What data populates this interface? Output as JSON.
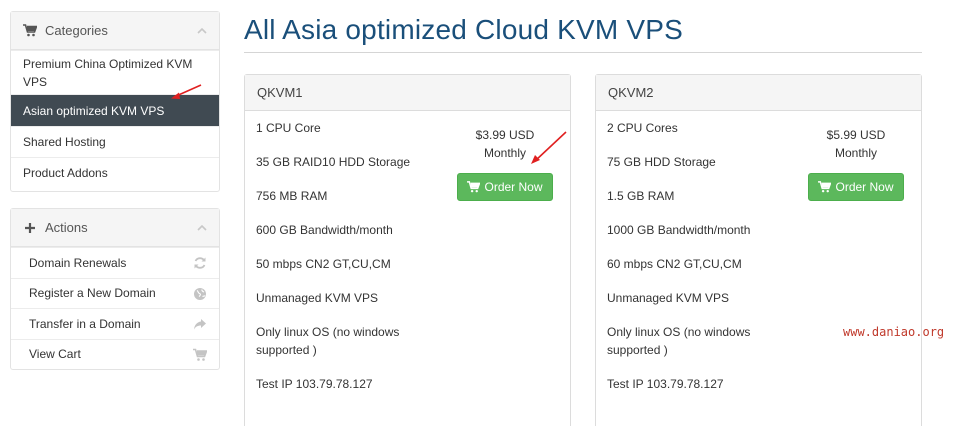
{
  "sidebar": {
    "categories": {
      "title": "Categories",
      "items": [
        {
          "label": "Premium China Optimized KVM VPS"
        },
        {
          "label": "Asian optimized KVM VPS"
        },
        {
          "label": "Shared Hosting"
        },
        {
          "label": "Product Addons"
        }
      ]
    },
    "actions": {
      "title": "Actions",
      "items": [
        {
          "label": "Domain Renewals",
          "icon": "refresh-icon"
        },
        {
          "label": "Register a New Domain",
          "icon": "globe-icon"
        },
        {
          "label": "Transfer in a Domain",
          "icon": "share-arrow-icon"
        },
        {
          "label": "View Cart",
          "icon": "cart-icon"
        }
      ]
    }
  },
  "main": {
    "title": "All Asia optimized Cloud KVM VPS",
    "products": [
      {
        "name": "QKVM1",
        "features": [
          "1 CPU Core",
          "35 GB RAID10 HDD Storage",
          "756 MB RAM",
          "600 GB Bandwidth/month",
          "50 mbps CN2 GT,CU,CM",
          "Unmanaged KVM VPS",
          "Only linux OS (no windows supported )",
          "Test IP 103.79.78.127"
        ],
        "price": "$3.99 USD",
        "cycle": "Monthly",
        "order_label": "Order Now"
      },
      {
        "name": "QKVM2",
        "features": [
          "2 CPU Cores",
          "75 GB HDD Storage",
          "1.5 GB RAM",
          "1000 GB Bandwidth/month",
          "60 mbps CN2 GT,CU,CM",
          "Unmanaged KVM VPS",
          "Only linux OS (no windows supported )",
          "Test IP 103.79.78.127"
        ],
        "price": "$5.99 USD",
        "cycle": "Monthly",
        "order_label": "Order Now"
      }
    ]
  },
  "watermark": "www.daniao.org",
  "colors": {
    "title": "#1a4f7a",
    "active_item_bg": "#404a52",
    "order_button": "#5cb85c",
    "annotation_arrow": "#e02020",
    "watermark": "#c0392b"
  }
}
